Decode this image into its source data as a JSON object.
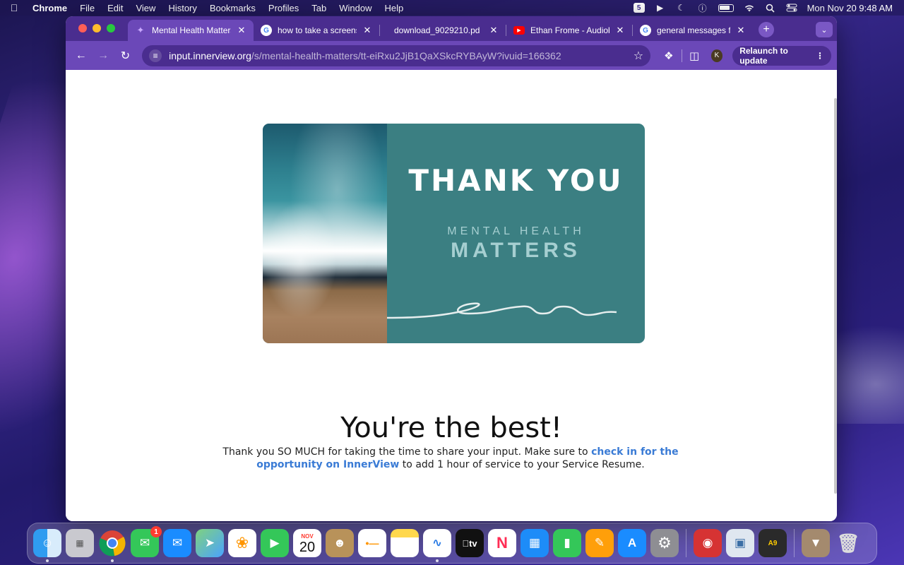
{
  "menubar": {
    "app_name": "Chrome",
    "items": [
      "File",
      "Edit",
      "View",
      "History",
      "Bookmarks",
      "Profiles",
      "Tab",
      "Window",
      "Help"
    ],
    "clock": "Mon Nov 20  9:48 AM"
  },
  "tabs": [
    {
      "title": "Mental Health Matters",
      "icon": "innerview-icon",
      "active": true
    },
    {
      "title": "how to take a screensh",
      "icon": "google-icon",
      "active": false
    },
    {
      "title": "download_9029210.pd",
      "icon": "none",
      "active": false
    },
    {
      "title": "Ethan Frome - Audiobo",
      "icon": "youtube-icon",
      "active": false
    },
    {
      "title": "general messages for c",
      "icon": "google-icon",
      "active": false
    }
  ],
  "toolbar": {
    "url_host": "input.innerview.org",
    "url_path": "/s/mental-health-matters/tt-eiRxu2JjB1QaXSkcRYBAyW?ivuid=166362",
    "avatar_letter": "K",
    "relaunch_label": "Relaunch to update"
  },
  "hero": {
    "title": "THANK YOU",
    "subtitle_line1": "MENTAL  HEALTH",
    "subtitle_line2": "MATTERS",
    "background_color": "#3b7f82"
  },
  "content": {
    "headline": "You're the best!",
    "body_before": "Thank you SO MUCH for taking the time to share your input. Make sure to ",
    "link_text": "check in for the opportunity on InnerView",
    "body_after": " to add 1 hour of service to your Service Resume."
  },
  "dock": {
    "apps": [
      "Finder",
      "Launchpad",
      "Chrome",
      "Messages",
      "Mail",
      "Maps",
      "Photos",
      "FaceTime",
      "Calendar",
      "Contacts",
      "Reminders",
      "Notes",
      "Freeform",
      "TV",
      "News",
      "Keynote",
      "Numbers",
      "Pages",
      "App Store",
      "System Settings",
      "Photo Booth",
      "Preview",
      "Asphalt",
      "Downloads",
      "Trash"
    ],
    "messages_badge": "1",
    "calendar_month": "NOV",
    "calendar_day": "20",
    "tv_label": "tv"
  }
}
